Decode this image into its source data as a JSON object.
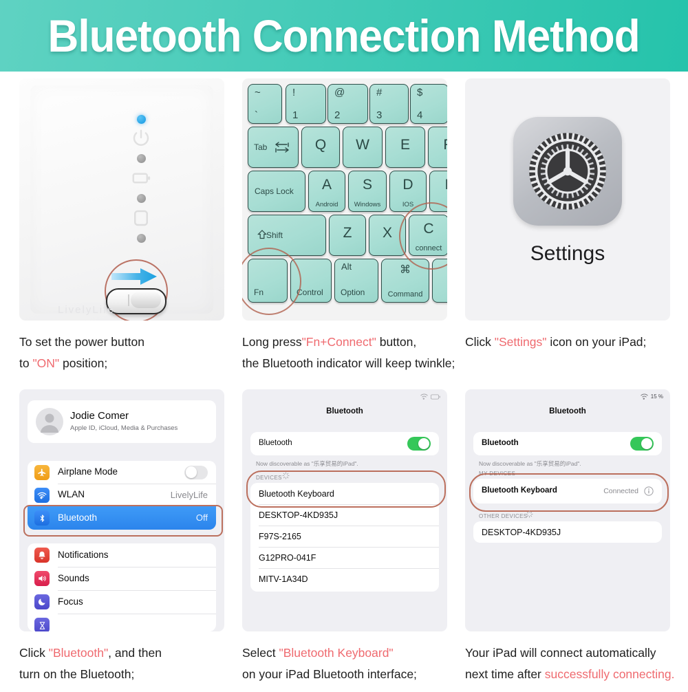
{
  "header": {
    "title": "Bluetooth Connection Method",
    "bg_start": "#5fd2c2",
    "bg_end": "#25c3ab"
  },
  "accent": {
    "highlight_text": "#ef6a6f",
    "ring": "#b5604c",
    "ios_blue": "#1a82f0",
    "ios_green": "#35c759"
  },
  "steps": [
    {
      "id": "step-power-switch",
      "caption_lines": [
        [
          {
            "t": "To set the power button",
            "hl": false
          }
        ],
        [
          {
            "t": "to ",
            "hl": false
          },
          {
            "t": "\"ON\"",
            "hl": true
          },
          {
            "t": " position;",
            "hl": false
          }
        ]
      ]
    },
    {
      "id": "step-fn-connect",
      "caption_lines": [
        [
          {
            "t": "Long press",
            "hl": false
          },
          {
            "t": "\"Fn+Connect\"",
            "hl": true
          },
          {
            "t": " button,",
            "hl": false
          }
        ],
        [
          {
            "t": "the Bluetooth indicator will keep twinkle;",
            "hl": false
          }
        ]
      ]
    },
    {
      "id": "step-open-settings",
      "caption_lines": [
        [
          {
            "t": "Click ",
            "hl": false
          },
          {
            "t": "\"Settings\"",
            "hl": true
          },
          {
            "t": " icon on your iPad;",
            "hl": false
          }
        ]
      ]
    },
    {
      "id": "step-tap-bluetooth",
      "caption_lines": [
        [
          {
            "t": "Click ",
            "hl": false
          },
          {
            "t": "\"Bluetooth\"",
            "hl": true
          },
          {
            "t": ", and then",
            "hl": false
          }
        ],
        [
          {
            "t": "turn on the Bluetooth;",
            "hl": false
          }
        ]
      ]
    },
    {
      "id": "step-select-keyboard",
      "caption_lines": [
        [
          {
            "t": "Select ",
            "hl": false
          },
          {
            "t": "\"Bluetooth Keyboard\"",
            "hl": true
          }
        ],
        [
          {
            "t": "on your iPad Bluetooth interface;",
            "hl": false
          }
        ]
      ]
    },
    {
      "id": "step-auto-connect",
      "caption_lines": [
        [
          {
            "t": "Your iPad will connect automatically",
            "hl": false
          }
        ],
        [
          {
            "t": "next time after ",
            "hl": false
          },
          {
            "t": "successfully connecting.",
            "hl": true
          }
        ]
      ]
    }
  ],
  "panel_power": {
    "leds": [
      "blue",
      "grey",
      "grey",
      "grey"
    ],
    "icons": [
      "power-icon",
      "battery-icon",
      "bluetooth-indicator-icon"
    ],
    "switch_state": "on",
    "arrow_direction": "right",
    "watermark": "LivelyLife"
  },
  "panel_keyboard": {
    "rows": [
      {
        "keys": [
          {
            "name": "tilde",
            "top": "~",
            "bottom": "`"
          },
          {
            "name": "one",
            "top": "!",
            "bottom": "1"
          },
          {
            "name": "two",
            "top": "@",
            "bottom": "2"
          },
          {
            "name": "three",
            "top": "#",
            "bottom": "3"
          },
          {
            "name": "four",
            "top": "$",
            "bottom": "4"
          },
          {
            "name": "five",
            "top": "",
            "bottom": ""
          }
        ]
      },
      {
        "keys": [
          {
            "name": "tab",
            "label": "Tab"
          },
          {
            "name": "q",
            "main": "Q"
          },
          {
            "name": "w",
            "main": "W"
          },
          {
            "name": "e",
            "main": "E"
          },
          {
            "name": "r",
            "main": "R"
          }
        ]
      },
      {
        "keys": [
          {
            "name": "caps-lock",
            "label": "Caps Lock"
          },
          {
            "name": "a",
            "main": "A",
            "sub": "Android"
          },
          {
            "name": "s",
            "main": "S",
            "sub": "Windows"
          },
          {
            "name": "d",
            "main": "D",
            "sub": "IOS"
          },
          {
            "name": "f",
            "main": "F"
          }
        ]
      },
      {
        "keys": [
          {
            "name": "shift",
            "label": "Shift"
          },
          {
            "name": "z",
            "main": "Z"
          },
          {
            "name": "x",
            "main": "X"
          },
          {
            "name": "c",
            "main": "C",
            "sub": "connect"
          }
        ]
      },
      {
        "keys": [
          {
            "name": "fn",
            "label": "Fn"
          },
          {
            "name": "control",
            "label": "Control"
          },
          {
            "name": "option",
            "top": "Alt",
            "label": "Option"
          },
          {
            "name": "command",
            "top": "⌘",
            "label": "Command"
          },
          {
            "name": "space",
            "label": ""
          }
        ]
      }
    ],
    "highlighted_keys": [
      "Fn",
      "C"
    ]
  },
  "panel_settings_icon": {
    "app_label": "Settings",
    "icon": "gear-icon"
  },
  "panel_ios_settings": {
    "account": {
      "name": "Jodie Comer",
      "subtitle": "Apple ID, iCloud, Media & Purchases",
      "avatar": "person-avatar"
    },
    "group1": [
      {
        "label": "Airplane Mode",
        "icon": "airplane-icon",
        "icon_color": "#f5a623",
        "control": "toggle",
        "toggle": "off",
        "value": ""
      },
      {
        "label": "WLAN",
        "icon": "wifi-icon",
        "icon_color": "#2f7cf6",
        "control": "value",
        "value": "LivelyLife"
      },
      {
        "label": "Bluetooth",
        "icon": "bluetooth-icon",
        "icon_color": "#2f7cf6",
        "control": "value",
        "value": "Off",
        "selected": true
      }
    ],
    "group2": [
      {
        "label": "Notifications",
        "icon": "bell-icon",
        "icon_color": "#e8453c"
      },
      {
        "label": "Sounds",
        "icon": "speaker-icon",
        "icon_color": "#e8335a"
      },
      {
        "label": "Focus",
        "icon": "moon-icon",
        "icon_color": "#5654d4"
      },
      {
        "label": "",
        "icon": "screen-time-icon",
        "icon_color": "#5654d4"
      }
    ]
  },
  "panel_bt_scan": {
    "nav_title": "Bluetooth",
    "bluetooth_row": {
      "label": "Bluetooth",
      "toggle": "on"
    },
    "discoverable_note": "Now discoverable as \"乐享贸易的iPad\".",
    "group_header": "DEVICES",
    "spinner": "activity-spinner",
    "devices": [
      {
        "name": "Bluetooth Keyboard",
        "highlighted": true
      },
      {
        "name": "DESKTOP-4KD935J"
      },
      {
        "name": "F97S-2165"
      },
      {
        "name": "G12PRO-041F"
      },
      {
        "name": "MITV-1A34D"
      }
    ],
    "status_bar": {
      "wifi": "wifi-icon",
      "battery": ""
    }
  },
  "panel_bt_connected": {
    "nav_title": "Bluetooth",
    "bluetooth_row": {
      "label": "Bluetooth",
      "toggle": "on"
    },
    "discoverable_note": "Now discoverable as \"乐享贸易的iPad\".",
    "my_devices_header": "MY DEVICES",
    "my_devices": [
      {
        "name": "Bluetooth Keyboard",
        "status": "Connected",
        "info": "info-icon",
        "highlighted": true
      }
    ],
    "other_devices_header": "OTHER DEVICES",
    "spinner": "activity-spinner",
    "other_devices": [
      {
        "name": "DESKTOP-4KD935J"
      }
    ],
    "status_bar": {
      "wifi": "wifi-icon",
      "battery": "15 %"
    }
  }
}
